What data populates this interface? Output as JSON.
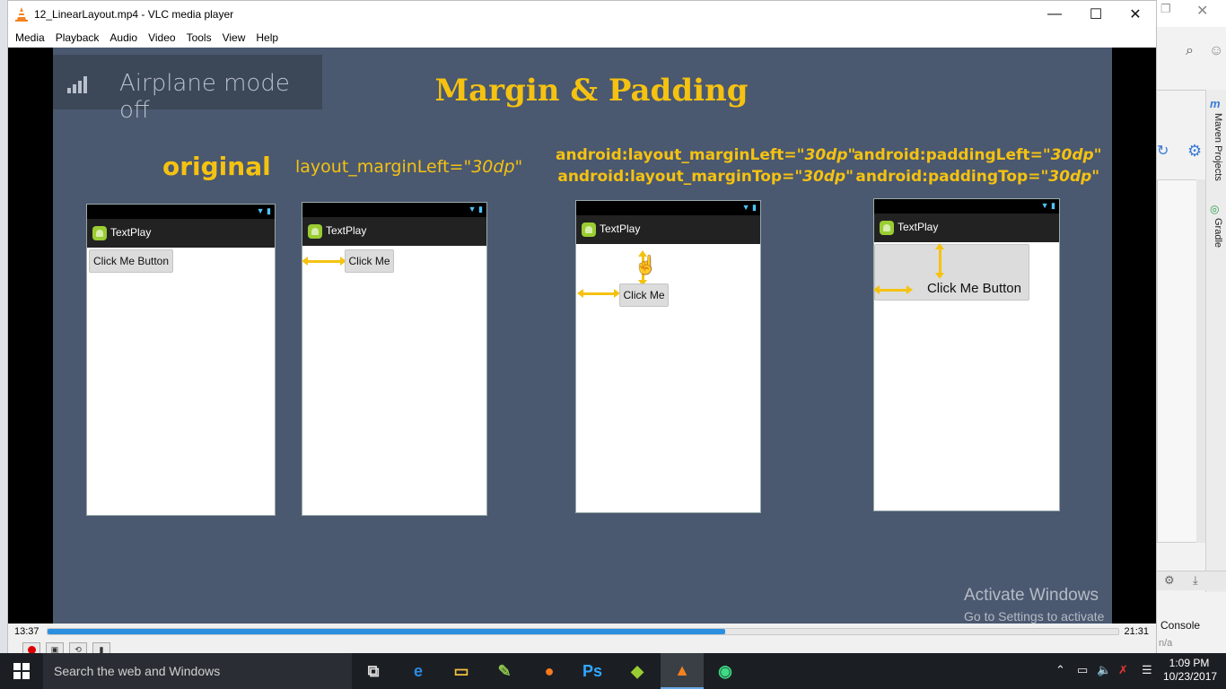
{
  "window": {
    "title": "12_LinearLayout.mp4 - VLC media player",
    "minimize": "—",
    "maximize": "☐",
    "close": "✕"
  },
  "menu": [
    "Media",
    "Playback",
    "Audio",
    "Video",
    "Tools",
    "View",
    "Help"
  ],
  "video": {
    "toast": "Airplane mode off",
    "slide_title": "Margin & Padding",
    "headers": {
      "original": "original",
      "margin_left_prefix": "layout_marginLeft=",
      "margin_left_value": "\"30dp\"",
      "margin_top_line1_prefix": "android:layout_marginLeft=",
      "margin_top_line1_value": "\"30dp\"",
      "margin_top_line2_prefix": "android:layout_marginTop=",
      "margin_top_line2_value": "\"30dp\"",
      "padding_line1_prefix": "android:paddingLeft=",
      "padding_line1_value": "\"30dp\"",
      "padding_line2_prefix": "android:paddingTop=",
      "padding_line2_value": "\"30dp\""
    },
    "phones": [
      {
        "app_title": "TextPlay",
        "button": "Click Me Button"
      },
      {
        "app_title": "TextPlay",
        "button": "Click Me"
      },
      {
        "app_title": "TextPlay",
        "button": "Click Me"
      },
      {
        "app_title": "TextPlay",
        "button": "Click Me Button"
      }
    ],
    "watermark": {
      "line1": "Activate Windows",
      "line2": "Go to Settings to activate Windows."
    }
  },
  "playback": {
    "elapsed": "13:37",
    "total": "21:31",
    "progress_fraction": 0.633
  },
  "taskbar": {
    "search_placeholder": "Search the web and Windows",
    "clock_time": "1:09 PM",
    "clock_date": "10/23/2017"
  },
  "background_ide": {
    "side_label_1": "Maven Projects",
    "side_label_2": "Gradle",
    "console_label": "Console",
    "na_text": "n/a"
  },
  "colors": {
    "slide_bg": "#4a5870",
    "accent_yellow": "#f5c211",
    "seek_fill": "#2b8fe0"
  }
}
